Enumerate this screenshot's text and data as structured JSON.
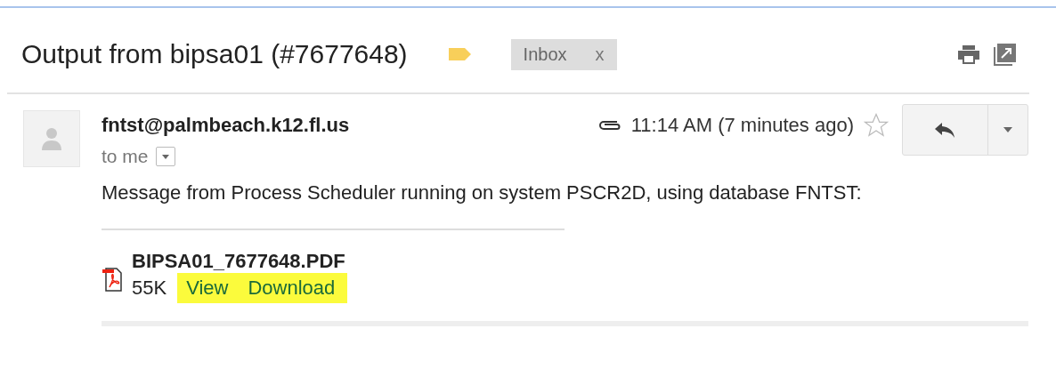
{
  "subject": "Output from bipsa01 (#7677648)",
  "labels": [
    {
      "name": "Inbox",
      "remove": "x"
    }
  ],
  "message": {
    "sender": "fntst@palmbeach.k12.fl.us",
    "recipient": "to me",
    "time": "11:14 AM (7 minutes ago)",
    "has_attachment": true,
    "starred": false,
    "body": "Message from Process Scheduler running on system PSCR2D, using database FNTST:"
  },
  "attachment": {
    "filename": "BIPSA01_7677648.PDF",
    "size": "55K",
    "highlighted": true,
    "actions": [
      "View",
      "Download"
    ]
  }
}
